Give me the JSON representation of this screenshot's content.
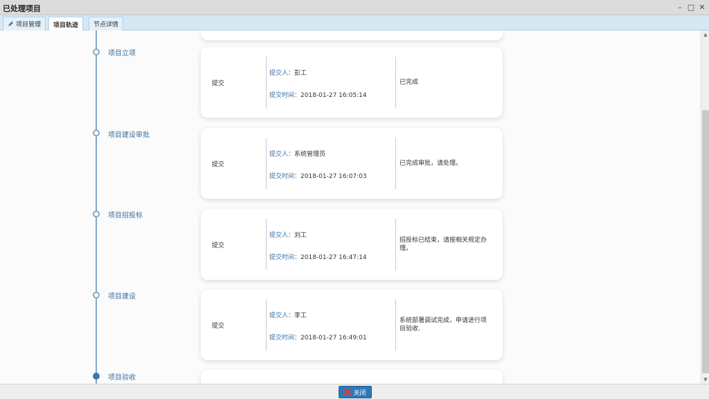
{
  "window": {
    "title": "已处理项目"
  },
  "tabs": [
    {
      "label": "项目管理",
      "icon": "pencil-icon"
    },
    {
      "label": "项目轨迹"
    },
    {
      "label": "节点详情"
    }
  ],
  "labels": {
    "submitter": "提交人：",
    "submit_time": "提交时间："
  },
  "stages": [
    {
      "name": "项目立项",
      "action": "提交",
      "submitter": "彭工",
      "time": "2018-01-27 16:05:14",
      "remark": "已完成"
    },
    {
      "name": "项目建设审批",
      "action": "提交",
      "submitter": "系统管理员",
      "time": "2018-01-27 16:07:03",
      "remark": "已完成审批，请处理。"
    },
    {
      "name": "项目招投标",
      "action": "提交",
      "submitter": "刘工",
      "time": "2018-01-27 16:47:14",
      "remark": "招投标已结束，请按相关规定办理。"
    },
    {
      "name": "项目建设",
      "action": "提交",
      "submitter": "李工",
      "time": "2018-01-27 16:49:01",
      "remark": "系统部署调试完成，申请进行项目验收."
    },
    {
      "name": "项目验收"
    }
  ],
  "footer": {
    "close_label": "关闭"
  },
  "colors": {
    "accent": "#2f77b6",
    "timeline": "#7fa7c9",
    "tab_bar": "#d5e9f5"
  }
}
